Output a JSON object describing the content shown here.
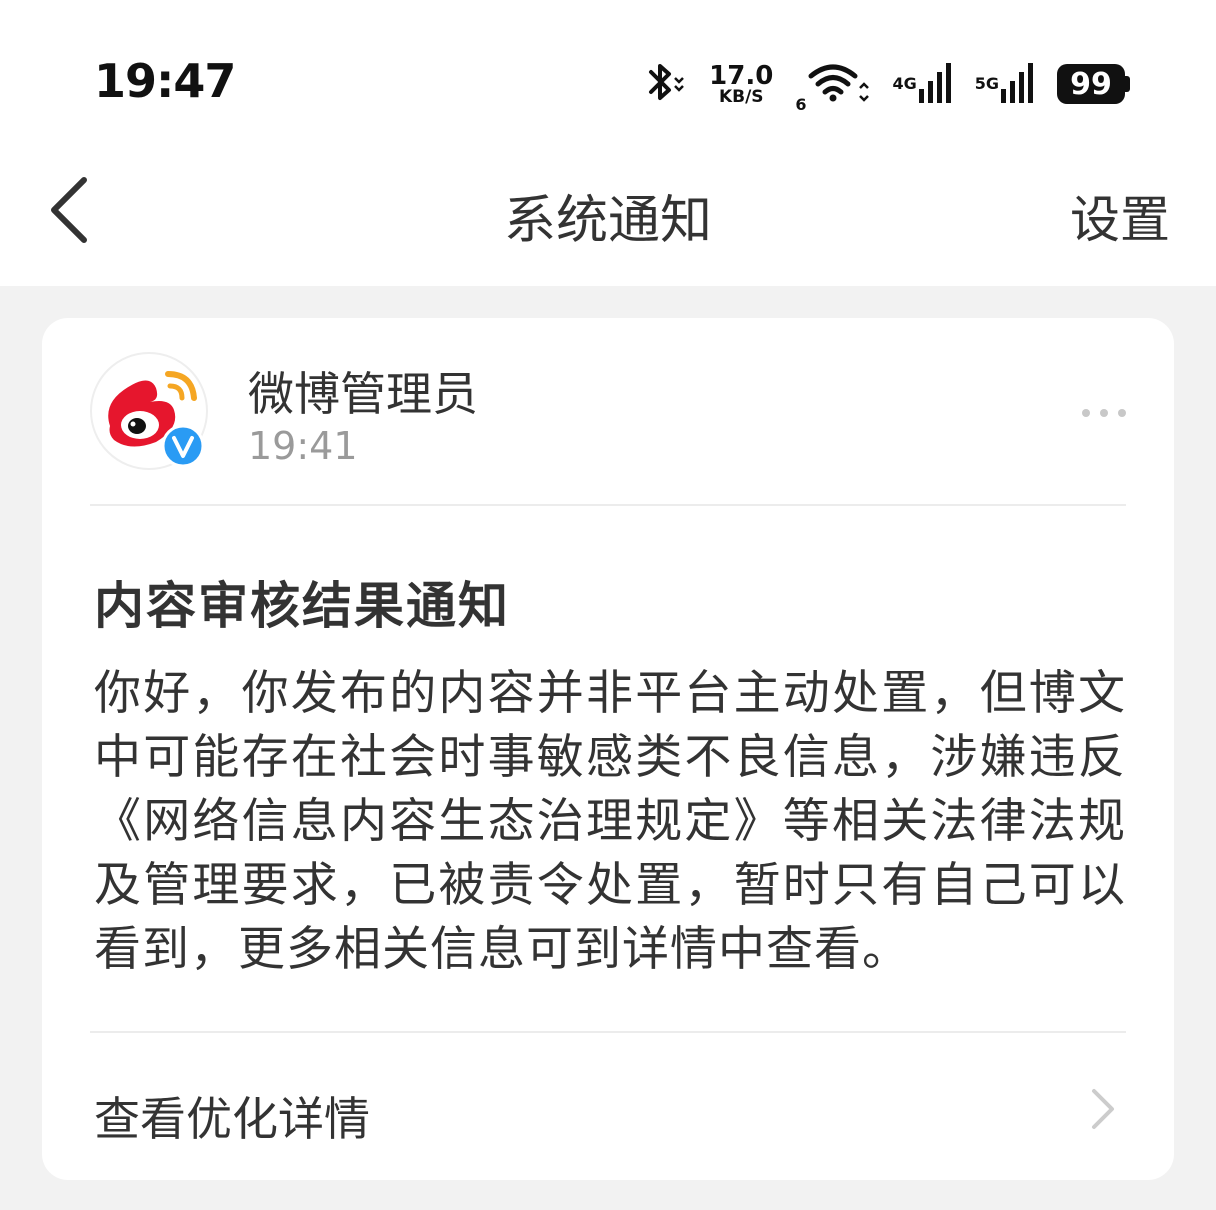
{
  "status_bar": {
    "time": "19:47",
    "net_speed_value": "17.0",
    "net_speed_unit": "KB/S",
    "wifi_label": "6",
    "sim1_label": "4G",
    "sim2_label": "5G",
    "battery": "99",
    "icons": [
      "bluetooth-icon",
      "wifi-icon",
      "signal-icon",
      "signal-icon",
      "battery-icon"
    ]
  },
  "nav": {
    "title": "系统通知",
    "settings_label": "设置",
    "back_icon": "chevron-left-icon"
  },
  "notification": {
    "sender_name": "微博管理员",
    "sender_time": "19:41",
    "title": "内容审核结果通知",
    "body": "你好，你发布的内容并非平台主动处置，但博文中可能存在社会时事敏感类不良信息，涉嫌违反《网络信息内容生态治理规定》等相关法律法规及管理要求，已被责令处置，暂时只有自己可以看到，更多相关信息可到详情中查看。",
    "detail_label": "查看优化详情"
  },
  "colors": {
    "background": "#f2f2f2",
    "card": "#ffffff",
    "text_primary": "#333333",
    "text_secondary": "#9a9a9a",
    "weibo_red": "#e6162d",
    "weibo_orange": "#f5a623",
    "verified_blue": "#2a9bf4"
  }
}
